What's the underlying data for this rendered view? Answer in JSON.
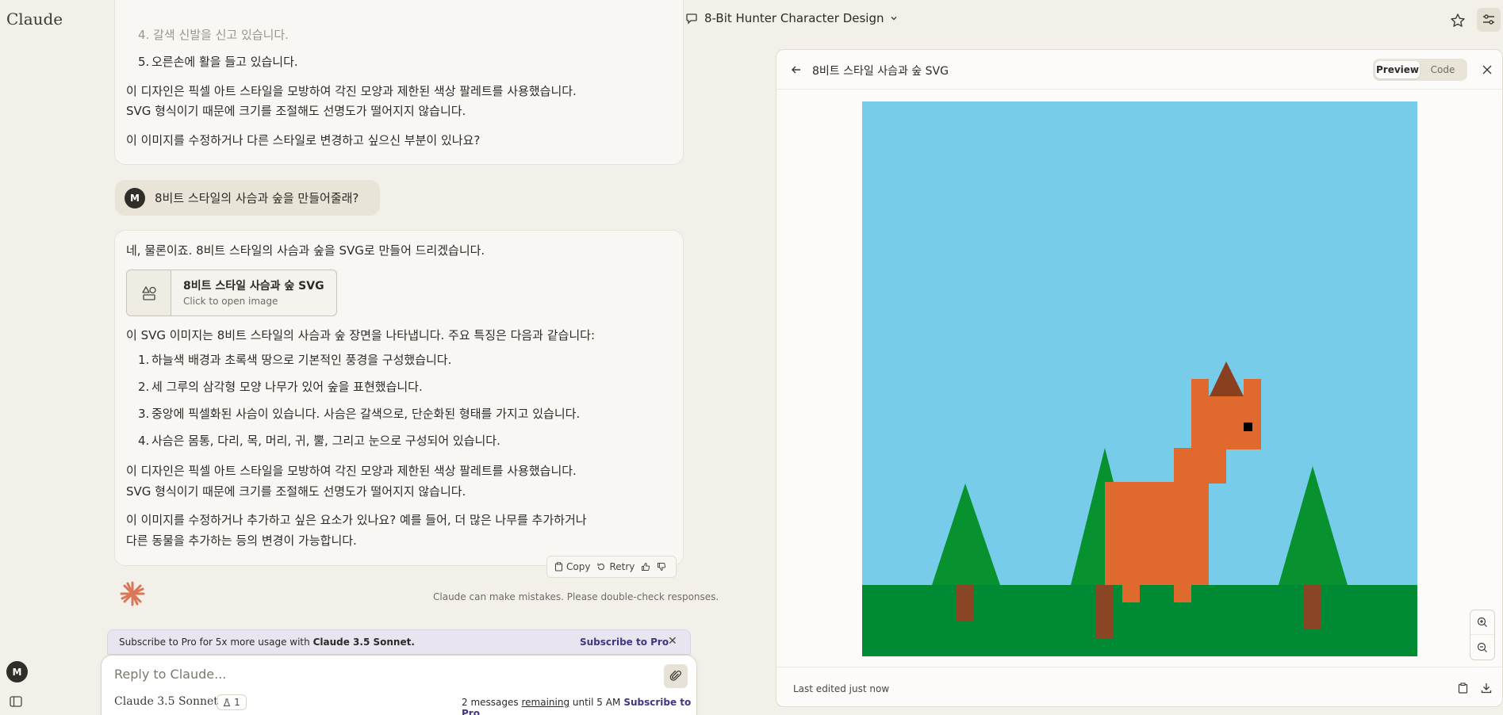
{
  "app": {
    "logo": "Claude"
  },
  "header": {
    "conversation_title": "8-Bit Hunter Character Design"
  },
  "messages": {
    "prev_assistant": {
      "faded_line": "4. 갈색 신발을 신고 있습니다.",
      "item5_num": "5.",
      "item5": "오른손에 활을 들고 있습니다.",
      "p1a": "이 디자인은 픽셀 아트 스타일을 모방하여 각진 모양과 제한된 색상 팔레트를 사용했습니다.",
      "p1b": "SVG 형식이기 때문에 크기를 조절해도 선명도가 떨어지지 않습니다.",
      "p2": "이 이미지를 수정하거나 다른 스타일로 변경하고 싶으신 부분이 있나요?"
    },
    "user": {
      "avatar": "M",
      "text": "8비트 스타일의 사슴과 숲을 만들어줄래?"
    },
    "assistant": {
      "intro": "네, 물론이죠. 8비트 스타일의 사슴과 숲을 SVG로 만들어 드리겠습니다.",
      "card_title": "8비트 스타일 사슴과 숲 SVG",
      "card_subtitle": "Click to open image",
      "lead": "이 SVG 이미지는 8비트 스타일의 사슴과 숲 장면을 나타냅니다. 주요 특징은 다음과 같습니다:",
      "items": [
        {
          "num": "1.",
          "text": "하늘색 배경과 초록색 땅으로 기본적인 풍경을 구성했습니다."
        },
        {
          "num": "2.",
          "text": "세 그루의 삼각형 모양 나무가 있어 숲을 표현했습니다."
        },
        {
          "num": "3.",
          "text": "중앙에 픽셀화된 사슴이 있습니다. 사슴은 갈색으로, 단순화된 형태를 가지고 있습니다."
        },
        {
          "num": "4.",
          "text": "사슴은 몸통, 다리, 목, 머리, 귀, 뿔, 그리고 눈으로 구성되어 있습니다."
        }
      ],
      "p1a": "이 디자인은 픽셀 아트 스타일을 모방하여 각진 모양과 제한된 색상 팔레트를 사용했습니다.",
      "p1b": "SVG 형식이기 때문에 크기를 조절해도 선명도가 떨어지지 않습니다.",
      "p2a": "이 이미지를 수정하거나 추가하고 싶은 요소가 있나요? 예를 들어, 더 많은 나무를 추가하거나",
      "p2b": "다른 동물을 추가하는 등의 변경이 가능합니다."
    }
  },
  "actions": {
    "copy": "Copy",
    "retry": "Retry"
  },
  "disclaimer": "Claude can make mistakes. Please double-check responses.",
  "subscribe_bar": {
    "text": "Subscribe to Pro for 5x more usage with",
    "model": "Claude 3.5 Sonnet.",
    "link": "Subscribe to Pro"
  },
  "composer": {
    "placeholder": "Reply to Claude...",
    "model": "Claude 3.5 Sonnet",
    "badge_count": "1",
    "remaining_pre": "2 messages",
    "remaining_word": "remaining",
    "remaining_post": "until 5 AM",
    "subscribe_link": "Subscribe to Pro"
  },
  "sidebar": {
    "avatar": "M"
  },
  "artifact": {
    "title": "8비트 스타일 사슴과 숲 SVG",
    "tab_preview": "Preview",
    "tab_code": "Code",
    "footer": "Last edited just now",
    "colors": {
      "sky": "#76cce9",
      "ground": "#008a33",
      "tree": "#07912f",
      "trunk": "#8a4524",
      "deer": "#e06a2d",
      "horn": "#8a3f1f",
      "eye": "#000000"
    }
  }
}
